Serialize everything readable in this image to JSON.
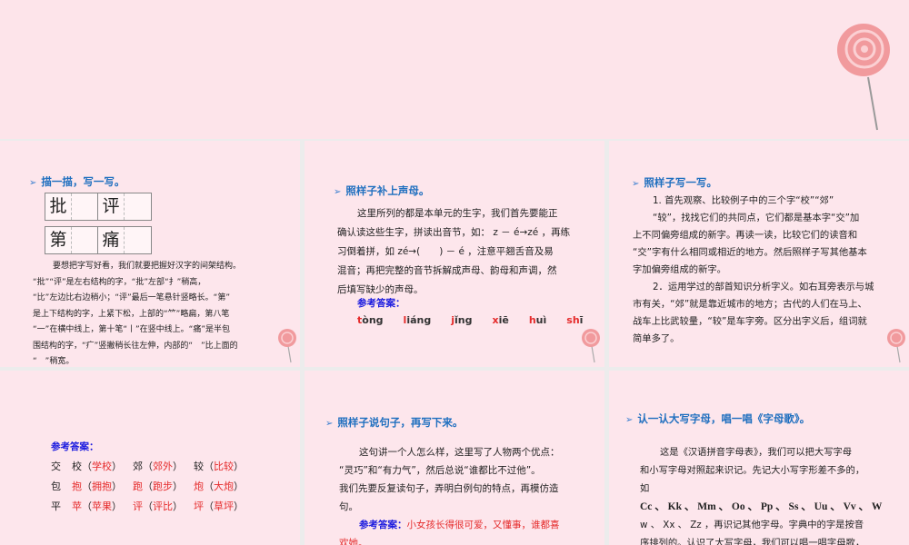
{
  "panel1": {
    "title": "描一描，写一写。",
    "chars": [
      "批",
      "评",
      "第",
      "痛"
    ],
    "lines": [
      "要想把字写好看，我们就要把握好汉字的间架结构。",
      "“批”“评”是左右结构的字，“批”左部“扌”稍高，",
      "“比”左边比右边稍小；“评”最后一笔悬针竖略长。“第”",
      "是上下结构的字，上紧下松，上部的“⺮”略扁，第八笔",
      "“一”在横中线上，第十笔“丨”在竖中线上。“痛”是半包",
      "围结构的字，“疒”竖撇稍长往左伸，内部的“　”比上面的",
      "“　”稍宽。"
    ]
  },
  "panel2": {
    "title": "照样子补上声母。",
    "lines": [
      "这里所列的都是本单元的生字，我们首先要能正",
      "确认读这些生字，拼读出音节，如： z － é→zé ，再练",
      "习倒着拼，如 zé→(　　) － é ，注意平翘舌音及易",
      "混音；再把完整的音节拆解成声母、韵母和声调，然",
      "后填写缺少的声母。"
    ],
    "answer_label": "参考答案：",
    "pinyin": [
      {
        "initial": "t",
        "rest": "òng"
      },
      {
        "initial": "l",
        "rest": "iáng"
      },
      {
        "initial": "j",
        "rest": "ǐng"
      },
      {
        "initial": "x",
        "rest": "iē"
      },
      {
        "initial": "h",
        "rest": "uì"
      },
      {
        "initial": "sh",
        "rest": "ī"
      }
    ]
  },
  "panel3": {
    "title": "照样子写一写。",
    "lines": [
      "1. 首先观察、比较例子中的三个字“校”“郊”",
      "“较”，找找它们的共同点，它们都是基本字“交”加",
      "上不同偏旁组成的新字。再读一读，比较它们的读音和",
      "“交”字有什么相同或相近的地方。然后照样子写其他基本",
      "字加偏旁组成的新字。",
      "2．运用学过的部首知识分析字义。如右耳旁表示与城",
      "市有关，“郊”就是靠近城市的地方；古代的人们在马上、",
      "战车上比武较量，“较”是车字旁。区分出字义后，组词就",
      "简单多了。"
    ]
  },
  "panel4": {
    "answer_label": "参考答案：",
    "rows": [
      {
        "base": "交",
        "items": [
          {
            "c": "校",
            "w": "学校",
            "cr": false
          },
          {
            "c": "郊",
            "w": "郊外",
            "cr": false
          },
          {
            "c": "较",
            "w": "比较",
            "cr": false
          }
        ]
      },
      {
        "base": "包",
        "items": [
          {
            "c": "抱",
            "w": "拥抱",
            "cr": true
          },
          {
            "c": "跑",
            "w": "跑步",
            "cr": true
          },
          {
            "c": "炮",
            "w": "大炮",
            "cr": true
          }
        ]
      },
      {
        "base": "平",
        "items": [
          {
            "c": "苹",
            "w": "苹果",
            "cr": true
          },
          {
            "c": "评",
            "w": "评比",
            "cr": true
          },
          {
            "c": "坪",
            "w": "草坪",
            "cr": true
          }
        ]
      }
    ]
  },
  "panel5": {
    "title": "照样子说句子，再写下来。",
    "lines": [
      "这句讲一个人怎么样，这里写了人物两个优点：",
      "“灵巧”和“有力气”，然后总说“谁都比不过他”。",
      "我们先要反复读句子，弄明白例句的特点，再模仿造",
      "句。"
    ],
    "answer_label": "参考答案：",
    "answer": "小女孩长得很可爱，又懂事，谁都喜",
    "answer2": "欢她。"
  },
  "panel6": {
    "title": "认一认大写字母，唱一唱《字母歌》。",
    "lines": [
      "这是《汉语拼音字母表》，我们可以把大写字母",
      "和小写字母对照起来识记。先记大小写字形差不多的，",
      "如",
      "Cc 、 Kk 、 Mm 、 Oo 、 Pp 、 Ss 、 Uu 、 Vv 、 W",
      "w 、 Xx 、 Zz ，再识记其他字母。字典中的字是按音",
      "序排列的。认识了大写字母，我们可以唱一唱字母歌，"
    ]
  }
}
